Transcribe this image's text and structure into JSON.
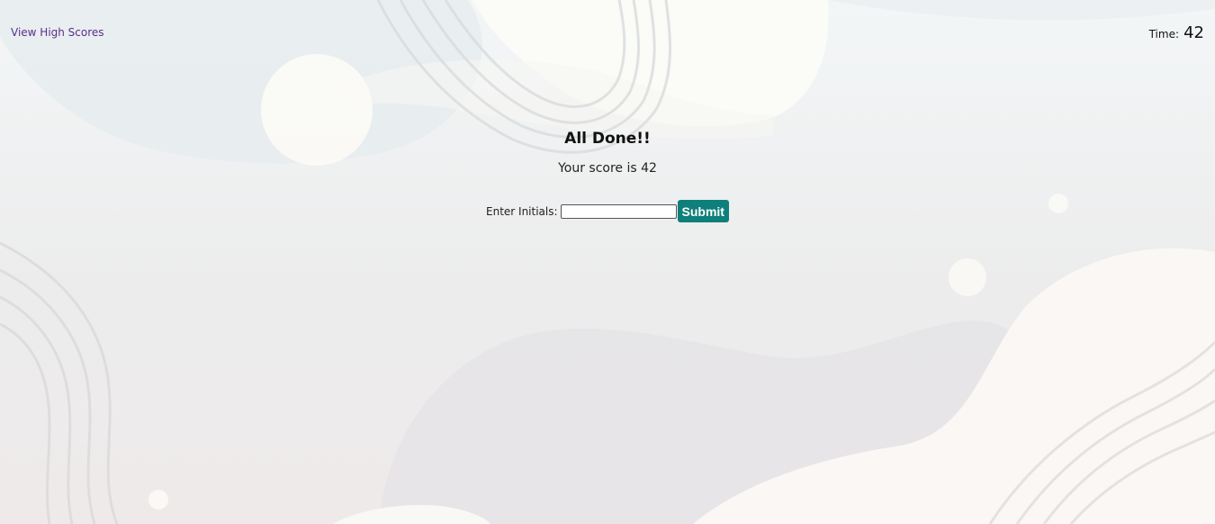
{
  "header": {
    "high_scores_link": "View High Scores",
    "timer_label": "Time:",
    "timer_value": "42"
  },
  "results": {
    "title": "All Done!!",
    "score_text": "Your score is 42"
  },
  "form": {
    "initials_label": "Enter Initials:",
    "initials_value": "",
    "submit_label": "Submit"
  },
  "colors": {
    "accent": "#0e7f7a",
    "link": "#5b2f8a"
  }
}
